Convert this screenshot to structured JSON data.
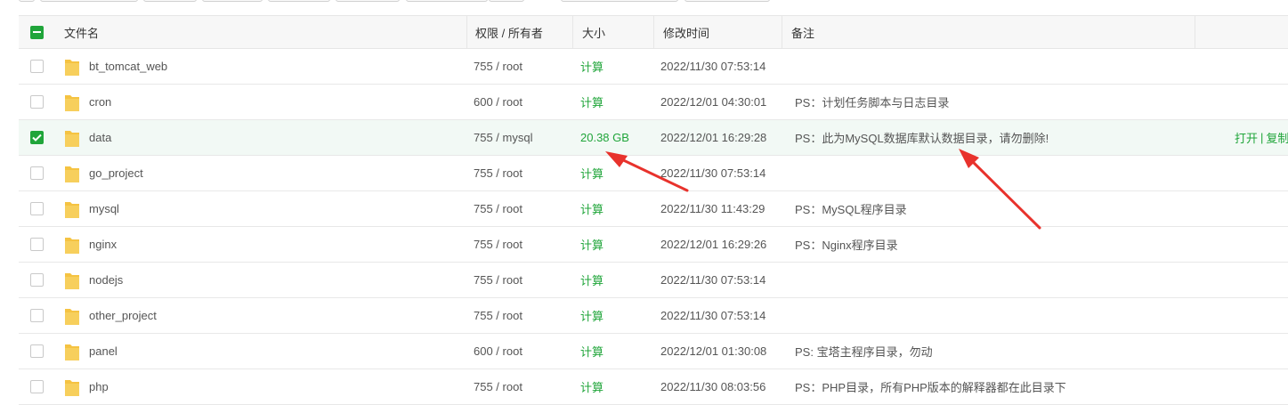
{
  "colors": {
    "accent": "#20a53a",
    "arrow": "#e8322c",
    "folder": "#f5c342"
  },
  "header": {
    "name": "文件名",
    "perm_owner": "权限 / 所有者",
    "size": "大小",
    "mtime": "修改时间",
    "note": "备注"
  },
  "rows": [
    {
      "name": "bt_tomcat_web",
      "perm": "755 / root",
      "size": "计算",
      "mtime": "2022/11/30 07:53:14",
      "note": ""
    },
    {
      "name": "cron",
      "perm": "600 / root",
      "size": "计算",
      "mtime": "2022/12/01 04:30:01",
      "note": "PS：计划任务脚本与日志目录"
    },
    {
      "name": "data",
      "perm": "755 / mysql",
      "size": "20.38 GB",
      "mtime": "2022/12/01 16:29:28",
      "note": "PS：此为MySQL数据库默认数据目录，请勿删除!",
      "selected": true,
      "op_open": "打开",
      "op_sep": "|",
      "op_copy": "复制"
    },
    {
      "name": "go_project",
      "perm": "755 / root",
      "size": "计算",
      "mtime": "2022/11/30 07:53:14",
      "note": ""
    },
    {
      "name": "mysql",
      "perm": "755 / root",
      "size": "计算",
      "mtime": "2022/11/30 11:43:29",
      "note": "PS：MySQL程序目录"
    },
    {
      "name": "nginx",
      "perm": "755 / root",
      "size": "计算",
      "mtime": "2022/12/01 16:29:26",
      "note": "PS：Nginx程序目录"
    },
    {
      "name": "nodejs",
      "perm": "755 / root",
      "size": "计算",
      "mtime": "2022/11/30 07:53:14",
      "note": ""
    },
    {
      "name": "other_project",
      "perm": "755 / root",
      "size": "计算",
      "mtime": "2022/11/30 07:53:14",
      "note": ""
    },
    {
      "name": "panel",
      "perm": "600 / root",
      "size": "计算",
      "mtime": "2022/12/01 01:30:08",
      "note": "PS: 宝塔主程序目录，勿动"
    },
    {
      "name": "php",
      "perm": "755 / root",
      "size": "计算",
      "mtime": "2022/11/30 08:03:56",
      "note": "PS：PHP目录，所有PHP版本的解释器都在此目录下"
    }
  ]
}
